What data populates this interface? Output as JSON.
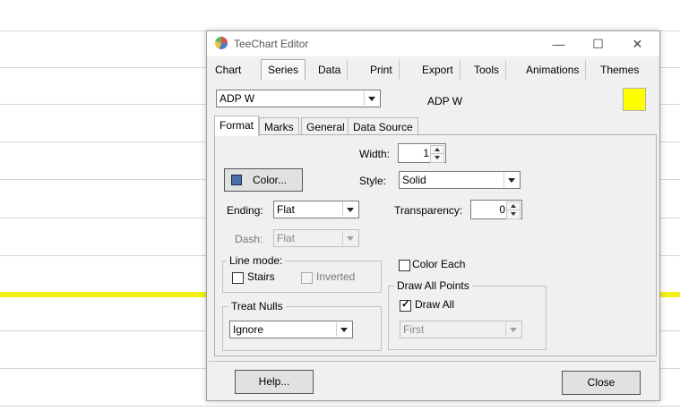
{
  "background": {
    "line_color": "#f2ee16",
    "arrow_color": "#e8261e"
  },
  "window": {
    "title": "TeeChart Editor",
    "controls": {
      "minimize": "—",
      "maximize": "☐",
      "close": "✕"
    }
  },
  "menu_tabs": [
    "Chart",
    "Series",
    "Data",
    "Print",
    "Export",
    "Tools",
    "Animations",
    "Themes"
  ],
  "active_menu_tab": "Series",
  "series_select": {
    "value": "ADP W"
  },
  "series_title": "ADP W",
  "series_color": "#ffff00",
  "sub_tabs": [
    "Format",
    "Marks",
    "General",
    "Data Source"
  ],
  "active_sub_tab": "Format",
  "format": {
    "color_button": "Color...",
    "color_swatch": "#4d6fa8",
    "width_label": "Width:",
    "width_value": "1",
    "style_label": "Style:",
    "style_value": "Solid",
    "ending_label": "Ending:",
    "ending_value": "Flat",
    "transparency_label": "Transparency:",
    "transparency_value": "0",
    "dash_label": "Dash:",
    "dash_value": "Flat",
    "line_mode": {
      "title": "Line mode:",
      "stairs": "Stairs",
      "inverted": "Inverted"
    },
    "color_each": "Color Each",
    "treat_nulls": {
      "title": "Treat Nulls",
      "value": "Ignore"
    },
    "draw_all_points": {
      "title": "Draw All Points",
      "draw_all": "Draw All",
      "value": "First"
    }
  },
  "buttons": {
    "help": "Help...",
    "close": "Close"
  }
}
